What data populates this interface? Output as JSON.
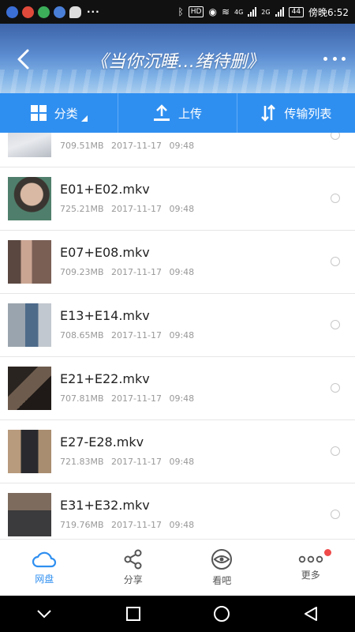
{
  "status_bar": {
    "hd_label": "HD",
    "net1": "4G",
    "net2": "2G",
    "battery": "44",
    "time": "傍晚6:52"
  },
  "header": {
    "title": "《当你沉睡…绪待删》"
  },
  "toolbar": {
    "category_label": "分类",
    "upload_label": "上传",
    "transfer_label": "传输列表"
  },
  "files": [
    {
      "name": "",
      "size": "709.51MB",
      "date": "2017-11-17 09:48"
    },
    {
      "name": "E01+E02.mkv",
      "size": "725.21MB",
      "date": "2017-11-17 09:48"
    },
    {
      "name": "E07+E08.mkv",
      "size": "709.23MB",
      "date": "2017-11-17 09:48"
    },
    {
      "name": "E13+E14.mkv",
      "size": "708.65MB",
      "date": "2017-11-17 09:48"
    },
    {
      "name": "E21+E22.mkv",
      "size": "707.81MB",
      "date": "2017-11-17 09:48"
    },
    {
      "name": "E27-E28.mkv",
      "size": "721.83MB",
      "date": "2017-11-17 09:48"
    },
    {
      "name": "E31+E32.mkv",
      "size": "719.76MB",
      "date": "2017-11-17 09:48"
    }
  ],
  "bottom_nav": {
    "netdisk": "网盘",
    "share": "分享",
    "watch": "看吧",
    "more": "更多"
  },
  "colors": {
    "accent": "#2f8ff0",
    "badge": "#f04a4a"
  }
}
